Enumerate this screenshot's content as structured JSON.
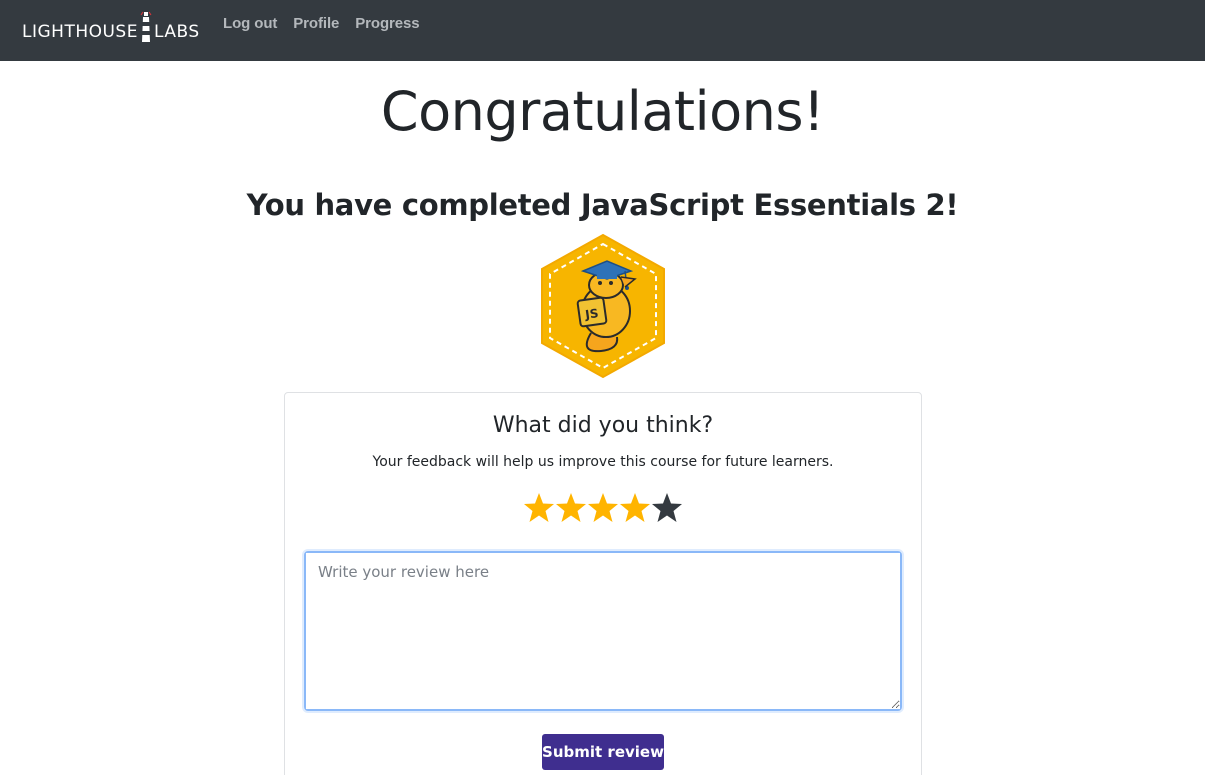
{
  "navbar": {
    "brand_left": "LIGHTHOUSE",
    "brand_right": "LABS",
    "links": [
      {
        "label": "Log out"
      },
      {
        "label": "Profile"
      },
      {
        "label": "Progress"
      }
    ],
    "background": "#343a40"
  },
  "main": {
    "title": "Congratulations!",
    "subtitle": "You have completed JavaScript Essentials 2!",
    "badge_text": "JS"
  },
  "feedback": {
    "heading": "What did you think?",
    "description": "Your feedback will help us improve this course for future learners.",
    "rating": 4,
    "max_rating": 5,
    "star_active_color": "#ffb400",
    "star_inactive_color": "#343a40",
    "review_placeholder": "Write your review here",
    "submit_label": "Submit review",
    "submit_color": "#3f2e8f"
  }
}
